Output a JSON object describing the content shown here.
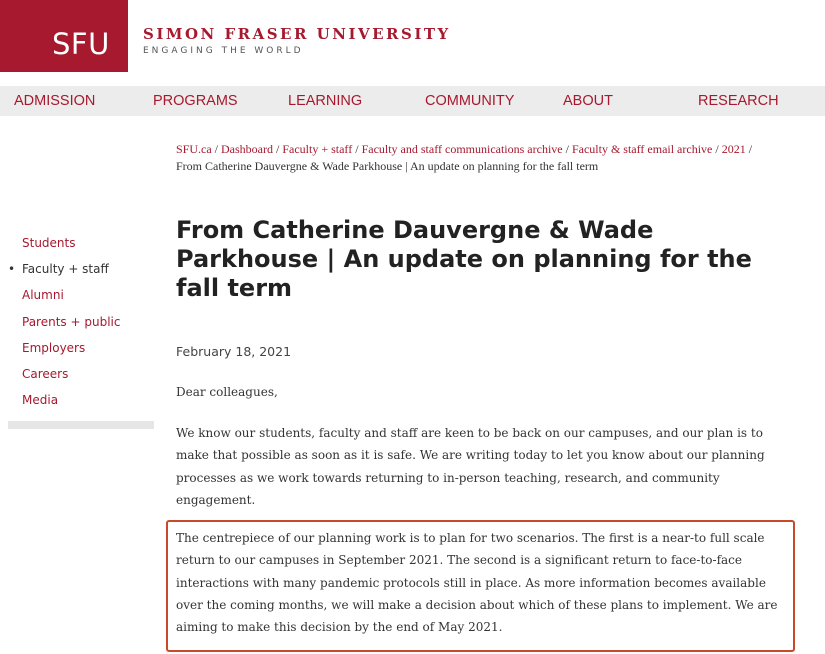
{
  "header": {
    "logo_text": "SFU",
    "university_name": "SIMON FRASER UNIVERSITY",
    "tagline": "ENGAGING THE WORLD",
    "brand_color": "#a6192e"
  },
  "nav": {
    "items": [
      "ADMISSION",
      "PROGRAMS",
      "LEARNING",
      "COMMUNITY",
      "ABOUT",
      "RESEARCH"
    ]
  },
  "breadcrumb": {
    "links": [
      "SFU.ca",
      "Dashboard",
      "Faculty + staff",
      "Faculty and staff communications archive",
      "Faculty & staff email archive",
      "2021"
    ],
    "separator": " / ",
    "current": "From Catherine Dauvergne & Wade Parkhouse | An update on planning for the fall term"
  },
  "sidebar": {
    "items": [
      {
        "label": "Students",
        "active": false
      },
      {
        "label": "Faculty + staff",
        "active": true
      },
      {
        "label": "Alumni",
        "active": false
      },
      {
        "label": "Parents + public",
        "active": false
      },
      {
        "label": "Employers",
        "active": false
      },
      {
        "label": "Careers",
        "active": false
      },
      {
        "label": "Media",
        "active": false
      }
    ],
    "bullet": "•"
  },
  "article": {
    "title": "From Catherine Dauvergne & Wade Parkhouse | An update on planning for the fall term",
    "date": "February 18, 2021",
    "greeting": "Dear colleagues,",
    "paragraph1": "We know our students, faculty and staff are keen to be back on our campuses, and our plan is to make that possible as soon as it is safe. We are writing today to let you know about our planning processes as we work towards returning to in-person teaching, research, and community engagement.",
    "paragraph2": "The centrepiece of our planning work is to plan for two scenarios. The first is a near-to full scale return to our campuses in September 2021. The second is a significant return to face-to-face interactions with many pandemic protocols still in place. As more information becomes available over the coming months, we will make a decision about which of these plans to implement. We are aiming to make this decision by the end of May 2021.",
    "highlight_color": "#c94a2a"
  }
}
